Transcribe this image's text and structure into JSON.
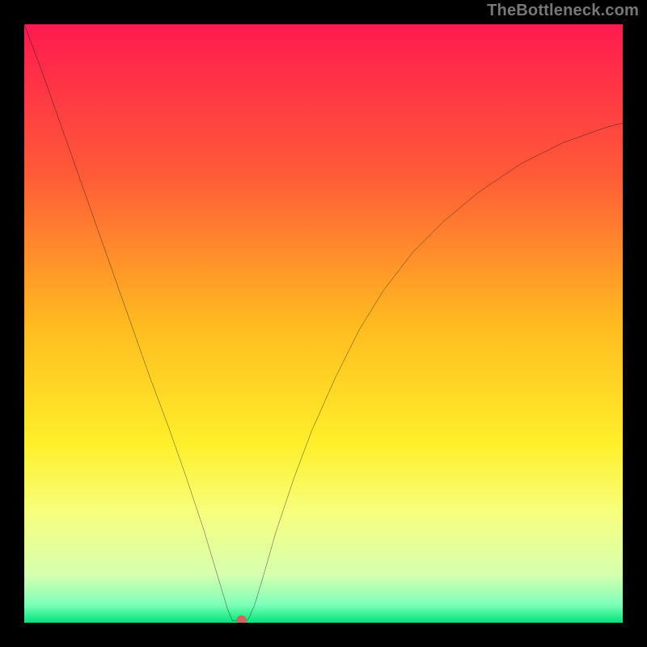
{
  "watermark": "TheBottleneck.com",
  "chart_data": {
    "type": "line",
    "title": "",
    "xlabel": "",
    "ylabel": "",
    "xlim": [
      0,
      100
    ],
    "ylim": [
      0,
      100
    ],
    "grid": false,
    "legend": false,
    "note": "Values are estimated from pixel positions; neither axis carries tick labels in the source image.",
    "background": {
      "type": "vertical-gradient",
      "stops": [
        {
          "pos": 0.0,
          "color": "#ff1a4f"
        },
        {
          "pos": 0.25,
          "color": "#ff5a38"
        },
        {
          "pos": 0.5,
          "color": "#ffba20"
        },
        {
          "pos": 0.7,
          "color": "#ffef2a"
        },
        {
          "pos": 0.82,
          "color": "#f6ff80"
        },
        {
          "pos": 0.92,
          "color": "#d6ffb0"
        },
        {
          "pos": 0.97,
          "color": "#7dffb8"
        },
        {
          "pos": 1.0,
          "color": "#00e57a"
        }
      ]
    },
    "series": [
      {
        "name": "curve",
        "color": "#000000",
        "x": [
          0,
          3,
          6,
          9,
          12,
          15,
          18,
          21,
          24,
          27,
          30,
          31.5,
          34,
          34.8,
          36.2,
          37,
          37.5,
          38.5,
          40,
          42,
          45,
          48,
          52,
          56,
          60,
          65,
          70,
          76,
          83,
          90,
          97,
          100
        ],
        "y": [
          100,
          92,
          83.5,
          75,
          66.5,
          58,
          49.5,
          41,
          33,
          24.5,
          15.5,
          10.5,
          2.2,
          0.3,
          0.3,
          0.3,
          0.7,
          3,
          8,
          15,
          24,
          32,
          41,
          49,
          55.5,
          62,
          67,
          72,
          76.7,
          80.2,
          82.7,
          83.5
        ]
      }
    ],
    "marker": {
      "x": 36.3,
      "y": 0.4,
      "color": "#c66a5f",
      "radius_pct": 0.85
    }
  }
}
